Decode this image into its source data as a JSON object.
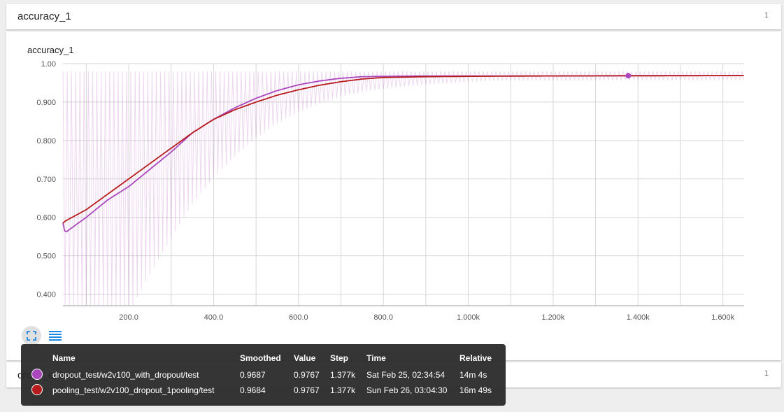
{
  "header": {
    "title": "accuracy_1",
    "count": "1"
  },
  "second_card": {
    "title": "cross_entropy_1",
    "count": "1"
  },
  "tooltip": {
    "columns": [
      "Name",
      "Smoothed",
      "Value",
      "Step",
      "Time",
      "Relative"
    ],
    "rows": [
      {
        "name": "dropout_test/w2v100_with_dropout/test",
        "smoothed": "0.9687",
        "value": "0.9767",
        "step": "1.377k",
        "time": "Sat Feb 25, 02:34:54",
        "relative": "14m 4s",
        "color": "#ab47bc"
      },
      {
        "name": "pooling_test/w2v100_dropout_1pooling/test",
        "smoothed": "0.9684",
        "value": "0.9767",
        "step": "1.377k",
        "time": "Sun Feb 26, 03:04:30",
        "relative": "16m 49s",
        "color": "#b71c1c"
      }
    ]
  },
  "icons": {
    "expand": "expand-icon",
    "legend": "legend-list-icon"
  },
  "chart_data": {
    "type": "line",
    "title": "accuracy_1",
    "xlim": [
      45,
      1650
    ],
    "ylim": [
      0.37,
      1.0
    ],
    "xticks": [
      200,
      400,
      600,
      800,
      1000,
      1200,
      1400,
      1600
    ],
    "xtick_labels": [
      "200.0",
      "400.0",
      "600.0",
      "800.0",
      "1.000k",
      "1.200k",
      "1.400k",
      "1.600k"
    ],
    "yticks": [
      0.4,
      0.5,
      0.6,
      0.7,
      0.8,
      0.9,
      1.0
    ],
    "ytick_labels": [
      "0.400",
      "0.500",
      "0.600",
      "0.700",
      "0.800",
      "0.900",
      "1.00"
    ],
    "grid": true,
    "highlight_step": 1377,
    "series": [
      {
        "name": "dropout_test/w2v100_with_dropout/test",
        "color": "#ab47bc",
        "x": [
          45,
          50,
          100,
          150,
          200,
          250,
          300,
          350,
          400,
          450,
          500,
          550,
          600,
          650,
          700,
          750,
          800,
          900,
          1000,
          1200,
          1377,
          1650
        ],
        "y": [
          0.585,
          0.56,
          0.6,
          0.645,
          0.68,
          0.725,
          0.77,
          0.82,
          0.855,
          0.885,
          0.91,
          0.93,
          0.945,
          0.955,
          0.962,
          0.966,
          0.967,
          0.968,
          0.968,
          0.968,
          0.9687,
          0.969
        ]
      },
      {
        "name": "pooling_test/w2v100_dropout_1pooling/test",
        "color": "#b71c1c",
        "x": [
          45,
          50,
          100,
          150,
          200,
          250,
          300,
          350,
          400,
          450,
          500,
          550,
          600,
          650,
          700,
          750,
          800,
          900,
          1000,
          1200,
          1377,
          1650
        ],
        "y": [
          0.585,
          0.59,
          0.62,
          0.66,
          0.7,
          0.74,
          0.78,
          0.82,
          0.855,
          0.88,
          0.9,
          0.918,
          0.932,
          0.944,
          0.953,
          0.96,
          0.964,
          0.966,
          0.967,
          0.968,
          0.9684,
          0.969
        ]
      }
    ]
  }
}
